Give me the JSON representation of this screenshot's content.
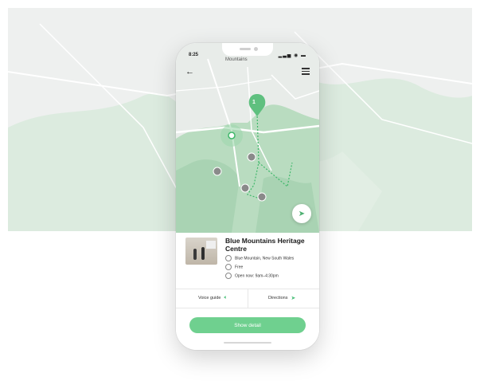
{
  "status": {
    "time": "8:25",
    "icons": "▂▃▅ ◉ ▬"
  },
  "map": {
    "area_label": "Mountains",
    "pin_number": "1"
  },
  "place": {
    "title": "Blue Mountains Heritage Centre",
    "location": "Blue Mountain, New South Wales",
    "price": "Free",
    "hours": "Open now: 9am–4:30pm"
  },
  "actions": {
    "voice_guide": "Voice guide",
    "directions": "Directions"
  },
  "show_detail": "Show detail",
  "colors": {
    "accent": "#6fd08f",
    "park": "#b9dcc0",
    "road": "#ffffff"
  }
}
